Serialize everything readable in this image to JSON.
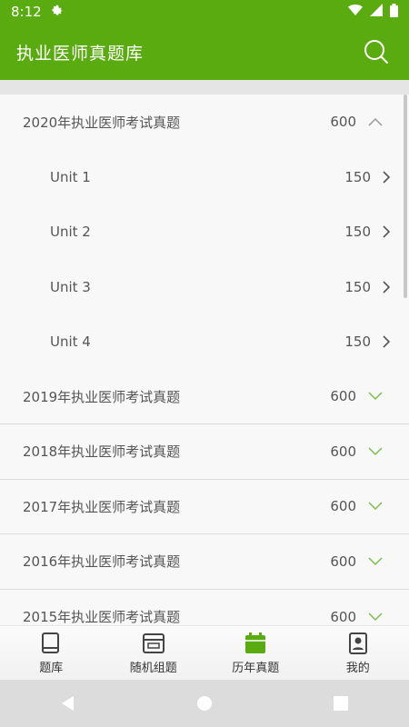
{
  "status_bar": {
    "time": "8:12",
    "icons": [
      "gear-icon",
      "wifi-icon",
      "signal-icon",
      "battery-icon"
    ]
  },
  "app_bar": {
    "title": "执业医师真题库",
    "search_icon": "search-icon"
  },
  "list": {
    "years": [
      {
        "label": "2020年执业医师考试真题",
        "count": "600",
        "expanded": true,
        "units": [
          {
            "label": "Unit 1",
            "count": "150"
          },
          {
            "label": "Unit 2",
            "count": "150"
          },
          {
            "label": "Unit 3",
            "count": "150"
          },
          {
            "label": "Unit 4",
            "count": "150"
          }
        ]
      },
      {
        "label": "2019年执业医师考试真题",
        "count": "600",
        "expanded": false
      },
      {
        "label": "2018年执业医师考试真题",
        "count": "600",
        "expanded": false
      },
      {
        "label": "2017年执业医师考试真题",
        "count": "600",
        "expanded": false
      },
      {
        "label": "2016年执业医师考试真题",
        "count": "600",
        "expanded": false
      },
      {
        "label": "2015年执业医师考试真题",
        "count": "600",
        "expanded": false
      }
    ]
  },
  "bottom_nav": {
    "tabs": [
      {
        "label": "题库",
        "icon": "book-icon"
      },
      {
        "label": "随机组题",
        "icon": "shuffle-card-icon"
      },
      {
        "label": "历年真题",
        "icon": "calendar-icon",
        "active": true
      },
      {
        "label": "我的",
        "icon": "profile-icon"
      }
    ]
  },
  "colors": {
    "primary": "#5aab10",
    "chevron_green": "#7bbf4a",
    "text": "#555555"
  }
}
